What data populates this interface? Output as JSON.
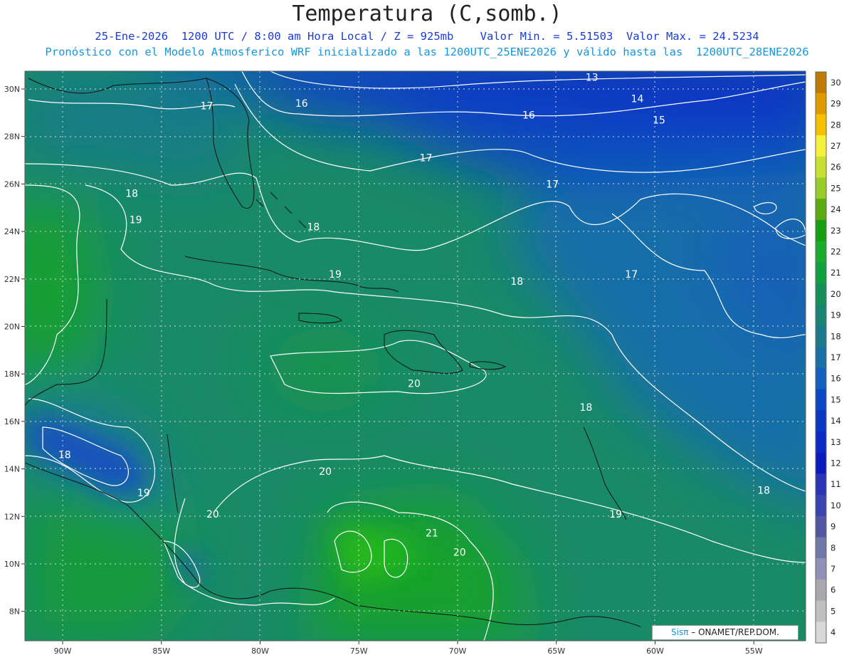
{
  "header": {
    "title": "Temperatura (C,somb.)",
    "subtitle_1": "25-Ene-2026  1200 UTC / 8:00 am Hora Local / Z = 925mb    Valor Min. = 5.51503  Valor Max. = 24.5234",
    "subtitle_2": "Pronóstico con el Modelo Atmosferico WRF inicializado a las 1200UTC_25ENE2026 y válido hasta las  1200UTC_28ENE2026"
  },
  "axes": {
    "lon_ticks": [
      "90W",
      "85W",
      "80W",
      "75W",
      "70W",
      "65W",
      "60W",
      "55W"
    ],
    "lat_ticks": [
      "30N",
      "28N",
      "26N",
      "24N",
      "22N",
      "20N",
      "18N",
      "16N",
      "14N",
      "12N",
      "10N",
      "8N"
    ]
  },
  "colorbar": {
    "levels": [
      "30",
      "29",
      "28",
      "27",
      "26",
      "25",
      "24",
      "23",
      "22",
      "21",
      "20",
      "19",
      "18",
      "17",
      "16",
      "15",
      "14",
      "13",
      "12",
      "11",
      "10",
      "9",
      "8",
      "7",
      "6",
      "5",
      "4"
    ],
    "colors": [
      "#c07a00",
      "#e09a00",
      "#f5c000",
      "#f5f03a",
      "#c8e030",
      "#98cc28",
      "#5aaa10",
      "#16a010",
      "#1aac2c",
      "#10a040",
      "#16905a",
      "#188472",
      "#1a7a8a",
      "#1870a6",
      "#1460c0",
      "#0a48c8",
      "#0838c4",
      "#0a2ac8",
      "#0a1cbe",
      "#2a34b6",
      "#3a44ae",
      "#5058a6",
      "#7078a8",
      "#9090b8",
      "#a8a8ac",
      "#c0c0c0",
      "#d8d8d8"
    ]
  },
  "contour_labels": [
    {
      "text": "13",
      "lon": -63.2,
      "lat": 30.5
    },
    {
      "text": "14",
      "lon": -60.9,
      "lat": 29.6
    },
    {
      "text": "15",
      "lon": -59.8,
      "lat": 28.7
    },
    {
      "text": "16",
      "lon": -77.9,
      "lat": 29.4
    },
    {
      "text": "16",
      "lon": -66.4,
      "lat": 28.9
    },
    {
      "text": "17",
      "lon": -82.7,
      "lat": 29.3
    },
    {
      "text": "17",
      "lon": -71.6,
      "lat": 27.1
    },
    {
      "text": "17",
      "lon": -65.2,
      "lat": 26.0
    },
    {
      "text": "17",
      "lon": -61.2,
      "lat": 22.2
    },
    {
      "text": "18",
      "lon": -86.5,
      "lat": 25.6
    },
    {
      "text": "18",
      "lon": -77.3,
      "lat": 24.2
    },
    {
      "text": "18",
      "lon": -67.0,
      "lat": 21.9
    },
    {
      "text": "18",
      "lon": -63.5,
      "lat": 16.6
    },
    {
      "text": "18",
      "lon": -89.9,
      "lat": 14.6
    },
    {
      "text": "18",
      "lon": -54.5,
      "lat": 13.1
    },
    {
      "text": "19",
      "lon": -86.3,
      "lat": 24.5
    },
    {
      "text": "19",
      "lon": -76.2,
      "lat": 22.2
    },
    {
      "text": "19",
      "lon": -85.9,
      "lat": 13.0
    },
    {
      "text": "19",
      "lon": -62.0,
      "lat": 12.1
    },
    {
      "text": "20",
      "lon": -72.2,
      "lat": 17.6
    },
    {
      "text": "20",
      "lon": -76.7,
      "lat": 13.9
    },
    {
      "text": "20",
      "lon": -82.4,
      "lat": 12.1
    },
    {
      "text": "20",
      "lon": -69.9,
      "lat": 10.5
    },
    {
      "text": "21",
      "lon": -71.3,
      "lat": 11.3
    }
  ],
  "credit": {
    "brand": "Sisπ",
    "text": "– ONAMET/REP.DOM."
  }
}
